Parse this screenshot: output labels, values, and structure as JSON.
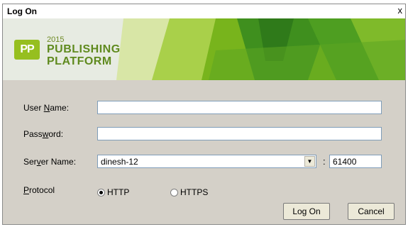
{
  "window": {
    "title": "Log On",
    "close_glyph": "x"
  },
  "banner": {
    "logo_badge": "PP",
    "logo_year": "2015",
    "logo_line1": "PUBLISHING",
    "logo_line2": "PLATFORM",
    "brand_green": "#96bf1f"
  },
  "form": {
    "username_label_pre": "User ",
    "username_label_u": "N",
    "username_label_post": "ame:",
    "username_value": "",
    "password_label_pre": "Pass",
    "password_label_u": "w",
    "password_label_post": "ord:",
    "password_value": "",
    "server_label_pre": "Ser",
    "server_label_u": "v",
    "server_label_post": "er Name:",
    "server_value": "dinesh-12",
    "port_separator": ":",
    "port_value": "61400",
    "protocol_label_u": "P",
    "protocol_label_post": "rotocol",
    "protocol_options": [
      "HTTP",
      "HTTPS"
    ],
    "protocol_selected": "HTTP"
  },
  "buttons": {
    "logon_label": "Log On",
    "cancel_label": "Cancel"
  }
}
